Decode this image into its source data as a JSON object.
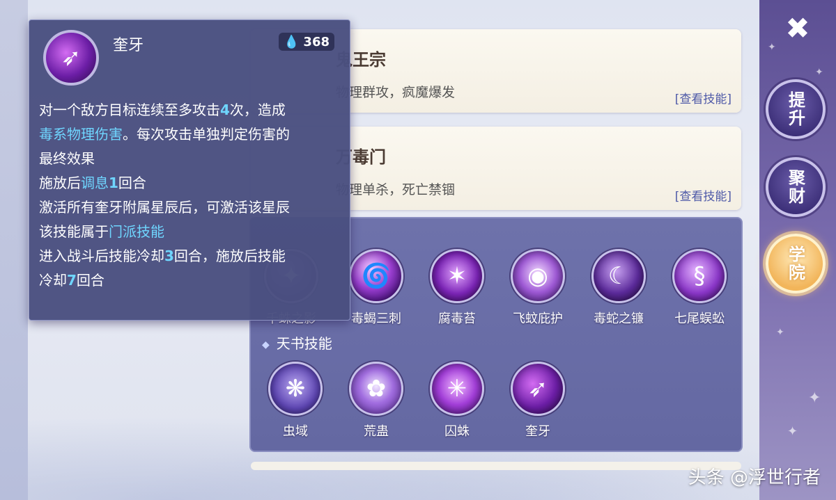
{
  "cards": [
    {
      "title": "鬼王宗",
      "title_visible": "鬼王宗",
      "desc": "物理群攻，疯魔爆发",
      "desc_visible": "理群攻，疯魔爆发",
      "link": "[查看技能]"
    },
    {
      "title": "万毒门",
      "title_visible": "万毒门",
      "desc": "物理单杀，死亡禁锢",
      "desc_visible": "理单杀，死亡禁锢",
      "link": "[查看技能]"
    }
  ],
  "side_buttons": [
    {
      "label": "提升",
      "active": false
    },
    {
      "label": "聚财",
      "active": false
    },
    {
      "label": "学院",
      "active": true
    }
  ],
  "skills_row1": [
    {
      "name": "千蛛之影",
      "icon": "spider-shadow-icon",
      "visible_name": "千蛛之影"
    },
    {
      "name": "毒蝎三刺",
      "icon": "scorpion-sting-icon"
    },
    {
      "name": "腐毒苔",
      "icon": "poison-moss-icon"
    },
    {
      "name": "飞蚊庇护",
      "icon": "mosquito-shield-icon"
    },
    {
      "name": "毒蛇之镰",
      "icon": "viper-scythe-icon"
    },
    {
      "name": "七尾蜈蚣",
      "icon": "centipede-icon"
    }
  ],
  "section_tianshu": "天书技能",
  "skills_row2": [
    {
      "name": "虫域",
      "icon": "wasp-icon"
    },
    {
      "name": "荒蛊",
      "icon": "gu-swirl-icon"
    },
    {
      "name": "囚蛛",
      "icon": "spider-icon"
    },
    {
      "name": "奎牙",
      "icon": "fang-icon"
    }
  ],
  "tooltip": {
    "title": "奎牙",
    "cost": "368",
    "line1_a": "对一个敌方目标连续至多攻击",
    "line1_num": "4",
    "line1_b": "次，造成",
    "line2_hl": "毒系物理伤害",
    "line2_b": "。每次攻击单独判定伤害的",
    "line3": "最终效果",
    "line4_a": "施放后",
    "line4_hl": "调息",
    "line4_num": "1",
    "line4_b": "回合",
    "line5": "激活所有奎牙附属星辰后，可激活该星辰",
    "line6_a": "该技能属于",
    "line6_hl": "门派技能",
    "line7_a": "进入战斗后技能冷却",
    "line7_num": "3",
    "line7_b": "回合，施放后技能",
    "line8_a": "冷却",
    "line8_num": "7",
    "line8_b": "回合"
  },
  "watermark": "头条 @浮世行者",
  "colors": {
    "accent_cyan": "#6fd6ff",
    "panel": "#6e72ab",
    "tooltip": "#4a5080",
    "active_button": "#f2b55a"
  }
}
